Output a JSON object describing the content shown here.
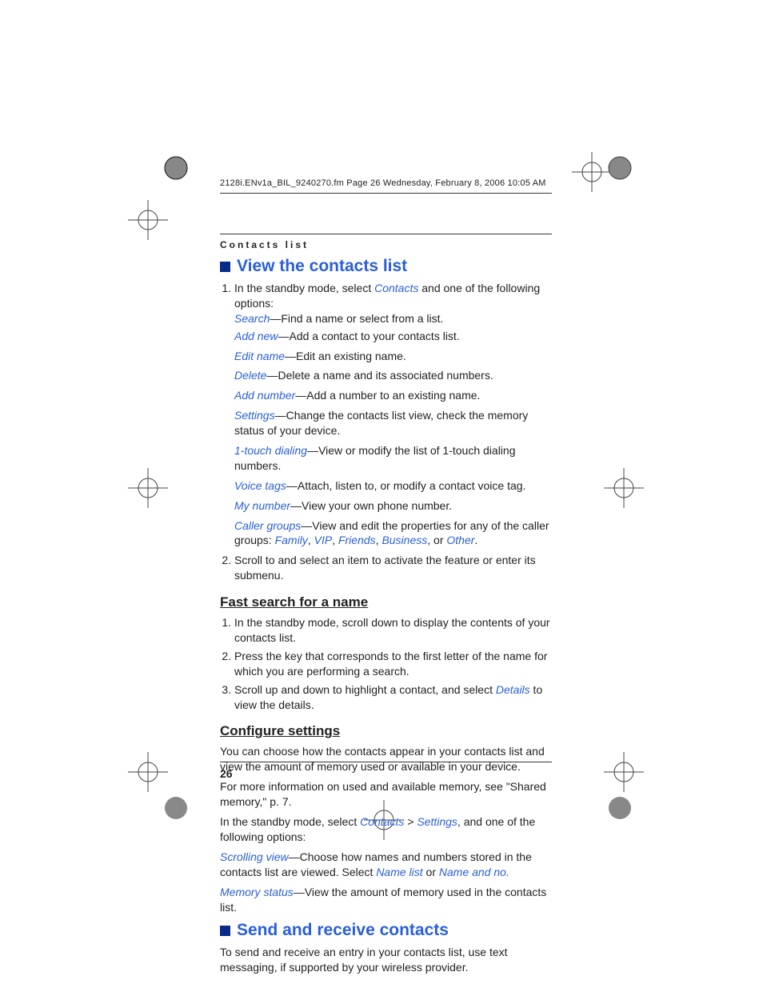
{
  "meta": {
    "header_line": "2128i.ENv1a_BIL_9240270.fm  Page 26  Wednesday, February 8, 2006  10:05 AM",
    "section_header": "Contacts list",
    "page_number": "26"
  },
  "s1": {
    "title": "View the contacts list",
    "p1_a": "In the standby mode, select ",
    "p1_link": "Contacts",
    "p1_b": " and one of the following options:",
    "opts": [
      {
        "l": "Search",
        "t": "—Find a name or select from a list."
      },
      {
        "l": "Add new",
        "t": "—Add a contact to your contacts list."
      },
      {
        "l": "Edit name",
        "t": "—Edit an existing name."
      },
      {
        "l": "Delete",
        "t": "—Delete a name and its associated numbers."
      },
      {
        "l": "Add number",
        "t": "—Add a number to an existing name."
      },
      {
        "l": "Settings",
        "t": "—Change the contacts list view, check the memory status of your device."
      },
      {
        "l": "1-touch dialing",
        "t": "—View or modify the list of 1-touch dialing numbers."
      },
      {
        "l": "Voice tags",
        "t": "—Attach, listen to, or modify a contact voice tag."
      },
      {
        "l": "My number",
        "t": "—View your own phone number."
      }
    ],
    "caller_l": "Caller groups",
    "caller_t": "—View and edit the properties for any of the caller groups: ",
    "groups": [
      "Family",
      "VIP",
      "Friends",
      "Business",
      "Other"
    ],
    "or": ", or ",
    "comma": ", ",
    "period": ".",
    "step2": "Scroll to and select an item to activate the feature or enter its submenu."
  },
  "s2": {
    "title": "Fast search for a name",
    "steps": [
      "In the standby mode, scroll down to display the contents of your contacts list.",
      "Press the key that corresponds to the first letter of the name for which you are performing a search."
    ],
    "step3_a": "Scroll up and down to highlight a contact, and select ",
    "step3_l": "Details",
    "step3_b": " to view the details."
  },
  "s3": {
    "title": "Configure settings",
    "p1": "You can choose how the contacts appear in your contacts list and view the amount of memory used or available in your device.",
    "p2": "For more information on used and available memory, see \"Shared memory,\" p. 7.",
    "p3_a": "In the standby mode, select ",
    "p3_l1": "Contacts",
    "p3_gt": " > ",
    "p3_l2": "Settings",
    "p3_b": ", and one of the following options:",
    "sv_l": "Scrolling view",
    "sv_t": "—Choose how names and numbers stored in the contacts list are viewed. Select ",
    "sv_o1": "Name list",
    "sv_or": " or ",
    "sv_o2": "Name and no.",
    "ms_l": "Memory status",
    "ms_t": "—View the amount of memory used in the contacts list."
  },
  "s4": {
    "title": "Send and receive contacts",
    "p1": "To send and receive an entry in your contacts list, use text messaging, if supported by your wireless provider."
  }
}
